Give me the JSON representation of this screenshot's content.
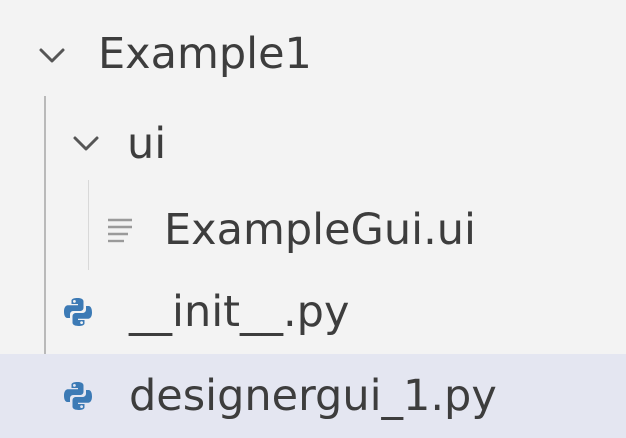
{
  "tree": {
    "root_folder": {
      "label": "Example1",
      "expanded": true,
      "chevron_icon": "chevron-down-icon"
    },
    "ui_folder": {
      "label": "ui",
      "expanded": true,
      "chevron_icon": "chevron-down-icon"
    },
    "files": [
      {
        "label": "ExampleGui.ui",
        "icon": "text-file-icon",
        "selected": false
      },
      {
        "label": "__init__.py",
        "icon": "python-icon",
        "selected": false
      },
      {
        "label": "designergui_1.py",
        "icon": "python-icon",
        "selected": true
      }
    ]
  },
  "colors": {
    "background": "#f3f3f3",
    "selected_row": "#e4e6f1",
    "text": "#3d3d3d",
    "python_blue": "#3c7ab5",
    "guide_line": "#b9b9b9"
  }
}
